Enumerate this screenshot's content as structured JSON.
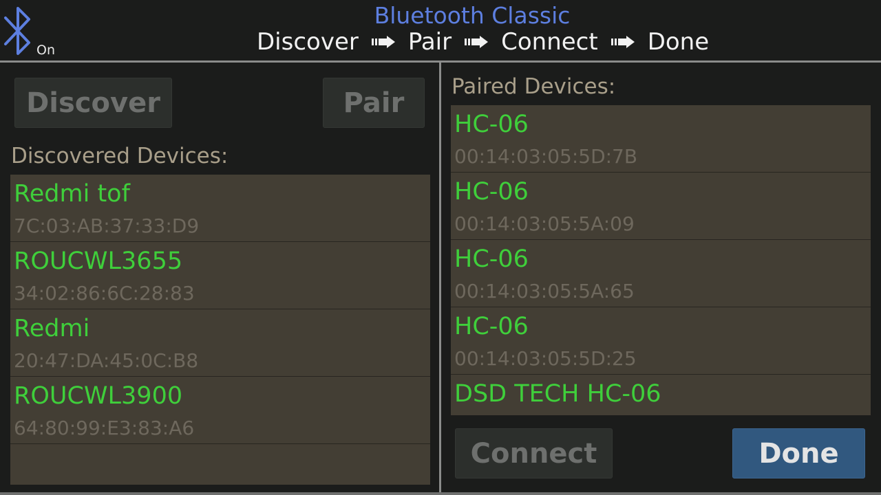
{
  "header": {
    "title": "Bluetooth Classic",
    "bluetooth_status": "On",
    "steps": [
      "Discover",
      "Pair",
      "Connect",
      "Done"
    ]
  },
  "buttons": {
    "discover": "Discover",
    "pair": "Pair",
    "connect": "Connect",
    "done": "Done"
  },
  "discovered": {
    "label": "Discovered Devices:",
    "devices": [
      {
        "name": "Redmi tof",
        "address": "7C:03:AB:37:33:D9"
      },
      {
        "name": "ROUCWL3655",
        "address": "34:02:86:6C:28:83"
      },
      {
        "name": "Redmi",
        "address": "20:47:DA:45:0C:B8"
      },
      {
        "name": "ROUCWL3900",
        "address": "64:80:99:E3:83:A6"
      }
    ]
  },
  "paired": {
    "label": "Paired Devices:",
    "devices": [
      {
        "name": "HC-06",
        "address": "00:14:03:05:5D:7B"
      },
      {
        "name": "HC-06",
        "address": "00:14:03:05:5A:09"
      },
      {
        "name": "HC-06",
        "address": "00:14:03:05:5A:65"
      },
      {
        "name": "HC-06",
        "address": "00:14:03:05:5D:25"
      },
      {
        "name": "DSD TECH HC-06",
        "address": ""
      }
    ]
  },
  "colors": {
    "title": "#5d7fe0",
    "device_name": "#3fcf3b",
    "device_address": "#6e685d",
    "list_background": "#433e34",
    "done_button": "#31587f",
    "bluetooth_icon": "#5d7fe0"
  },
  "icons": {
    "bluetooth": "bluetooth-icon",
    "step_arrow": "arrow-right-icon"
  }
}
